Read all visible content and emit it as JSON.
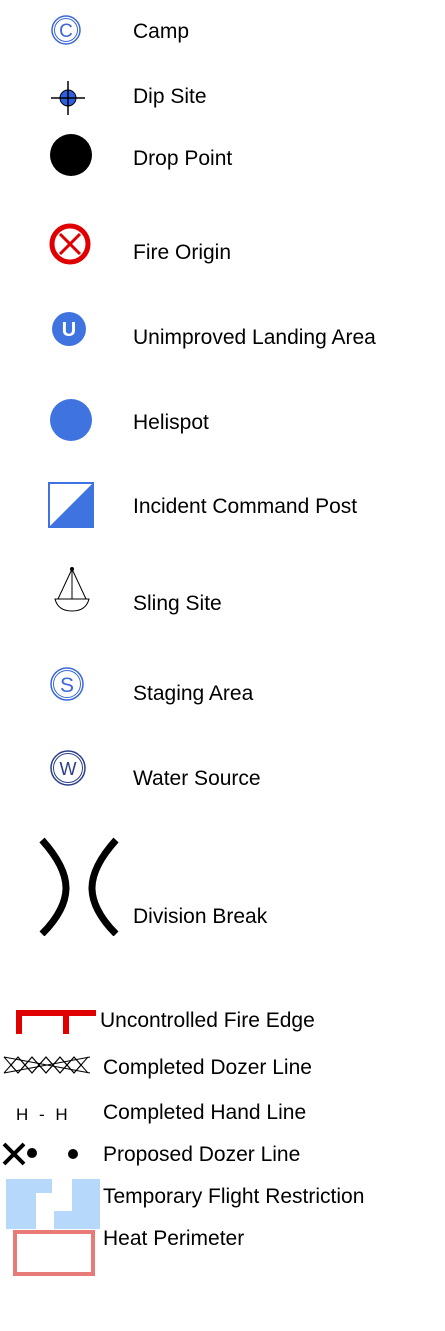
{
  "legend": {
    "camp": "Camp",
    "dip_site": "Dip Site",
    "drop_point": "Drop Point",
    "fire_origin": "Fire Origin",
    "unimproved_landing_area": "Unimproved Landing Area",
    "helispot": "Helispot",
    "incident_command_post": "Incident Command Post",
    "sling_site": "Sling Site",
    "staging_area": "Staging Area",
    "water_source": "Water Source",
    "division_break": "Division Break",
    "uncontrolled_fire_edge": "Uncontrolled Fire Edge",
    "completed_dozer_line": "Completed Dozer Line",
    "completed_hand_line": "Completed Hand Line",
    "proposed_dozer_line": "Proposed Dozer Line",
    "temporary_flight_restriction": "Temporary Flight Restriction",
    "heat_perimeter": "Heat Perimeter"
  },
  "glyphs": {
    "camp": "C",
    "unimproved_landing_area": "U",
    "staging_area": "S",
    "water_source": "W",
    "hand_line": "H - H"
  },
  "colors": {
    "blue_fill": "#3f74e0",
    "outline_blue": "#3b67d9",
    "red": "#e00000",
    "tfr_blue": "#b6d8fb",
    "heat_pink": "#e87a78"
  }
}
